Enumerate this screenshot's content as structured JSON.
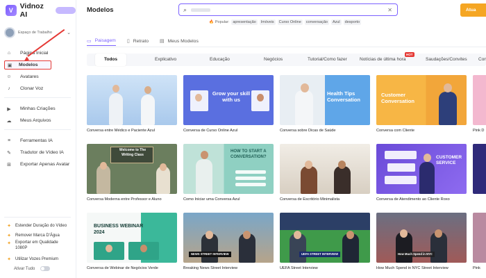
{
  "app": {
    "name": "Vidnoz AI",
    "logo_letter": "V"
  },
  "workspace": {
    "label": "Espaço de Trabalho"
  },
  "sidebar": {
    "nav": [
      {
        "label": "Página Inicial",
        "icon": "home-icon",
        "glyph": "⌂"
      },
      {
        "label": "Modelos",
        "icon": "template-icon",
        "glyph": "▣"
      },
      {
        "label": "Avatares",
        "icon": "avatar-icon",
        "glyph": "☺"
      },
      {
        "label": "Clonar Voz",
        "icon": "voice-icon",
        "glyph": "♪"
      },
      {
        "label": "Minhas Criações",
        "icon": "play-icon",
        "glyph": "▶"
      },
      {
        "label": "Meus Arquivos",
        "icon": "cloud-icon",
        "glyph": "☁"
      },
      {
        "label": "Ferramentas IA",
        "icon": "tools-icon",
        "glyph": "≡"
      },
      {
        "label": "Tradutor de Vídeo IA",
        "icon": "translate-icon",
        "glyph": "✎"
      },
      {
        "label": "Exportar Apenas Avatar",
        "icon": "export-icon",
        "glyph": "⊞"
      }
    ],
    "promos": [
      {
        "label": "Estender Duração do Vídeo"
      },
      {
        "label": "Remover Marca D'Água"
      },
      {
        "label": "Exportar em Qualidade 1080P"
      },
      {
        "label": "Utilizar Vozes Premium"
      }
    ],
    "toggle_label": "Ativar Tudo",
    "promo_glyph": "✦"
  },
  "header": {
    "title": "Modelos",
    "search_icon": "⌕",
    "clear_icon": "✕",
    "popular_label": "Popular:",
    "popular_tags": [
      "apresentação",
      "Imóveis",
      "Curso Online",
      "conversação",
      "Azul",
      "desporto"
    ],
    "cta_label": "Atua"
  },
  "tabs": [
    {
      "label": "Paisagem",
      "glyph": "▭"
    },
    {
      "label": "Retrato",
      "glyph": "▯"
    },
    {
      "label": "Meus Modelos",
      "glyph": "▤"
    }
  ],
  "categories": [
    "Todos",
    "Explicativo",
    "Educação",
    "Negócios",
    "Tutorial/Como fazer",
    "Notícias de última hora",
    "Saudações/Convites",
    "Con"
  ],
  "hot_badge": "HOT",
  "cards": [
    {
      "title": "Conversa entre Médico e Paciente Azul"
    },
    {
      "title": "Conversa de Curso Online Azul",
      "overlay": "Grow your skill with us"
    },
    {
      "title": "Conversa sobre Dicas de Saúde",
      "overlay": "Health Tips Conversation"
    },
    {
      "title": "Conversa com Cliente",
      "overlay": "Customer Conversation"
    },
    {
      "title": "Pink D"
    },
    {
      "title": "Conversa Moderna entre Professor e Aluno",
      "overlay": "Welcome to The Writing Class"
    },
    {
      "title": "Como Iniciar uma Conversa Azul",
      "overlay": "HOW TO START A CONVERSATION?"
    },
    {
      "title": "Conversa de Escritório Minimalista"
    },
    {
      "title": "Conversa de Atendimento ao Cliente Roxo",
      "overlay": "CUSTOMER SERVICE"
    },
    {
      "title": ""
    },
    {
      "title": "Conversa de Webinar de Negócios Verde",
      "overlay": "BUSINESS WEBINAR 2024"
    },
    {
      "title": "Breaking News Street Interview",
      "overlay": "NEWS STREET INTERVIEW"
    },
    {
      "title": "UEFA Street Interview",
      "overlay": "UEFA STREET INTERVIEW"
    },
    {
      "title": "How Much Spend in NYC Street Interview",
      "overlay": "How Much Spend in NYC"
    },
    {
      "title": "Pink"
    }
  ]
}
